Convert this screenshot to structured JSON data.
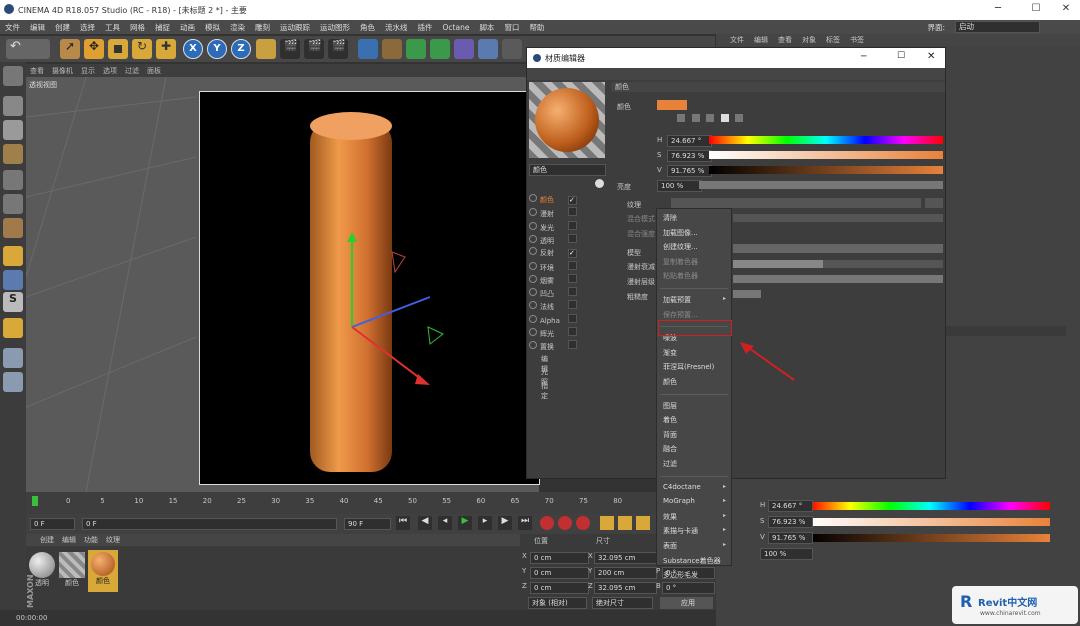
{
  "app": {
    "title": "CINEMA 4D R18.057 Studio (RC - R18) - [未标题 2 *] - 主要",
    "layout_label": "界面:",
    "layout_value": "启动"
  },
  "menu": [
    "文件",
    "编辑",
    "创建",
    "选择",
    "工具",
    "网格",
    "捕捉",
    "动画",
    "模拟",
    "渲染",
    "雕刻",
    "运动跟踪",
    "运动图形",
    "角色",
    "流水线",
    "插件",
    "Octane",
    "脚本",
    "窗口",
    "帮助"
  ],
  "toolbar": {
    "x": "X",
    "y": "Y",
    "z": "Z"
  },
  "viewport": {
    "menu": [
      "查看",
      "摄像机",
      "显示",
      "选项",
      "过滤",
      "面板"
    ],
    "label": "透视视图"
  },
  "timeline": {
    "ticks": [
      "0",
      "5",
      "10",
      "15",
      "20",
      "25",
      "30",
      "35",
      "40",
      "45",
      "50",
      "55",
      "60",
      "65",
      "70",
      "75",
      "80"
    ],
    "frame_start": "0 F",
    "frame_end": "90 F",
    "current": "0 F"
  },
  "materials": {
    "menu": [
      "创建",
      "编辑",
      "功能",
      "纹理"
    ],
    "items": [
      {
        "name": "透明",
        "color": "#9a9a9a"
      },
      {
        "name": "颜色",
        "color": "#9a9a9a"
      },
      {
        "name": "颜色",
        "color": "#e07a30"
      }
    ]
  },
  "coords": {
    "headers": [
      "位置",
      "尺寸",
      "旋转"
    ],
    "rows": [
      {
        "axis": "X",
        "pos": "0 cm",
        "size": "32.095 cm",
        "rot_axis": "H",
        "rot": "0 °"
      },
      {
        "axis": "Y",
        "pos": "0 cm",
        "size": "200 cm",
        "rot_axis": "P",
        "rot": "0 °"
      },
      {
        "axis": "Z",
        "pos": "0 cm",
        "size": "32.095 cm",
        "rot_axis": "B",
        "rot": "0 °"
      }
    ],
    "mode": "对象 (相对)",
    "size_mode": "绝对尺寸",
    "apply": "应用"
  },
  "status": {
    "time": "00:00:00"
  },
  "right": {
    "menu": [
      "文件",
      "编辑",
      "查看",
      "对象",
      "标签",
      "书签"
    ]
  },
  "mated": {
    "title": "材质编辑器",
    "name": "颜色",
    "section": "颜色",
    "color_label": "颜色",
    "hsv": {
      "h_label": "H",
      "h": "24.667 °",
      "s_label": "S",
      "s": "76.923 %",
      "v_label": "V",
      "v": "91.765 %"
    },
    "brightness_label": "亮度",
    "brightness": "100 %",
    "texture_label": "纹理",
    "channels": [
      {
        "label": "颜色",
        "checked": true
      },
      {
        "label": "漫射",
        "checked": false
      },
      {
        "label": "发光",
        "checked": false
      },
      {
        "label": "透明",
        "checked": false
      },
      {
        "label": "反射",
        "checked": true
      },
      {
        "label": "环境",
        "checked": false
      },
      {
        "label": "烟雾",
        "checked": false
      },
      {
        "label": "凹凸",
        "checked": false
      },
      {
        "label": "法线",
        "checked": false
      },
      {
        "label": "Alpha",
        "checked": false
      },
      {
        "label": "辉光",
        "checked": false
      },
      {
        "label": "置换",
        "checked": false
      }
    ],
    "extra": [
      "编辑",
      "光照",
      "指定"
    ],
    "params": [
      "混合模式",
      "混合强度",
      "模型",
      "漫射衰减",
      "漫射层级",
      "粗糙度"
    ]
  },
  "context_menu": {
    "items": [
      {
        "label": "清除",
        "dim": false
      },
      {
        "label": "加载图像...",
        "dim": false
      },
      {
        "label": "创建纹理...",
        "dim": false
      },
      {
        "label": "复制着色器",
        "dim": true
      },
      {
        "label": "粘贴着色器",
        "dim": true
      },
      {
        "label": "加载预置",
        "dim": false,
        "sub": true
      },
      {
        "label": "保存预置...",
        "dim": true
      },
      {
        "label": "噪波",
        "dim": false
      },
      {
        "label": "渐变",
        "dim": false
      },
      {
        "label": "菲涅耳(Fresnel)",
        "dim": false
      },
      {
        "label": "颜色",
        "dim": false
      },
      {
        "label": "图层",
        "dim": false
      },
      {
        "label": "着色",
        "dim": false
      },
      {
        "label": "背面",
        "dim": false
      },
      {
        "label": "融合",
        "dim": false
      },
      {
        "label": "过滤",
        "dim": false
      },
      {
        "label": "C4doctane",
        "dim": false,
        "sub": true
      },
      {
        "label": "MoGraph",
        "dim": false,
        "sub": true
      },
      {
        "label": "效果",
        "dim": false,
        "sub": true
      },
      {
        "label": "素描与卡通",
        "dim": false,
        "sub": true
      },
      {
        "label": "表面",
        "dim": false,
        "sub": true
      },
      {
        "label": "Substance着色器",
        "dim": false
      },
      {
        "label": "多边形毛发",
        "dim": false
      }
    ]
  },
  "colors": {
    "accent": "#e8823a",
    "highlight_box": "#d02020",
    "arrow": "#d02020"
  },
  "watermark": {
    "brand": "Revit中文网",
    "url": "www.chinarevit.com"
  }
}
